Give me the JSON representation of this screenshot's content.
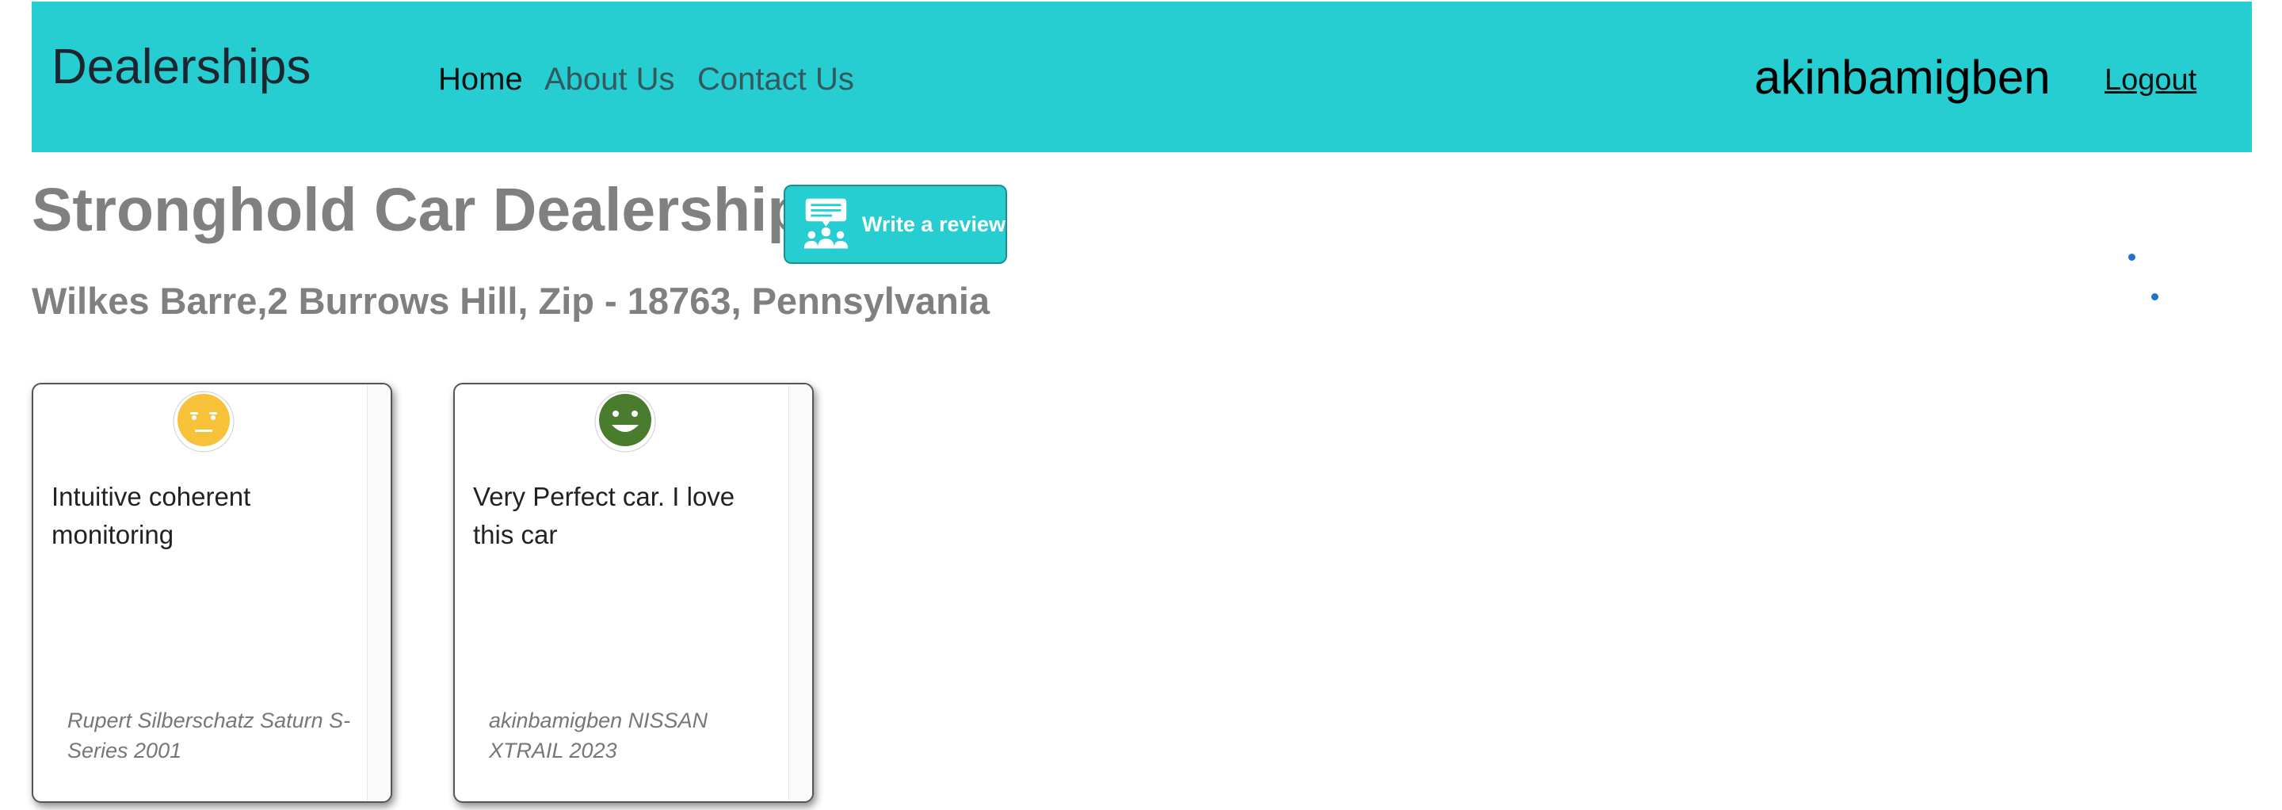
{
  "navbar": {
    "brand": "Dealerships",
    "links": [
      {
        "label": "Home"
      },
      {
        "label": "About Us"
      },
      {
        "label": "Contact Us"
      }
    ],
    "username": "akinbamigben",
    "logout_label": "Logout"
  },
  "dealer": {
    "name": "Stronghold Car Dealership",
    "address": "Wilkes Barre,2 Burrows Hill, Zip - 18763, Pennsylvania",
    "write_review_label": "Write a review"
  },
  "reviews": [
    {
      "sentiment": "neutral",
      "sentiment_icon": "neutral-face-icon",
      "text": "Intuitive coherent monitoring",
      "reviewer": "Rupert Silberschatz Saturn S-Series 2001"
    },
    {
      "sentiment": "positive",
      "sentiment_icon": "smiling-face-icon",
      "text": "Very Perfect car. I love this car",
      "reviewer": "akinbamigben NISSAN XTRAIL 2023"
    }
  ],
  "colors": {
    "navbar_bg": "#26cdd1",
    "neutral_face": "#f7c23a",
    "positive_face": "#4a7c2e",
    "heading_gray": "#808080"
  }
}
